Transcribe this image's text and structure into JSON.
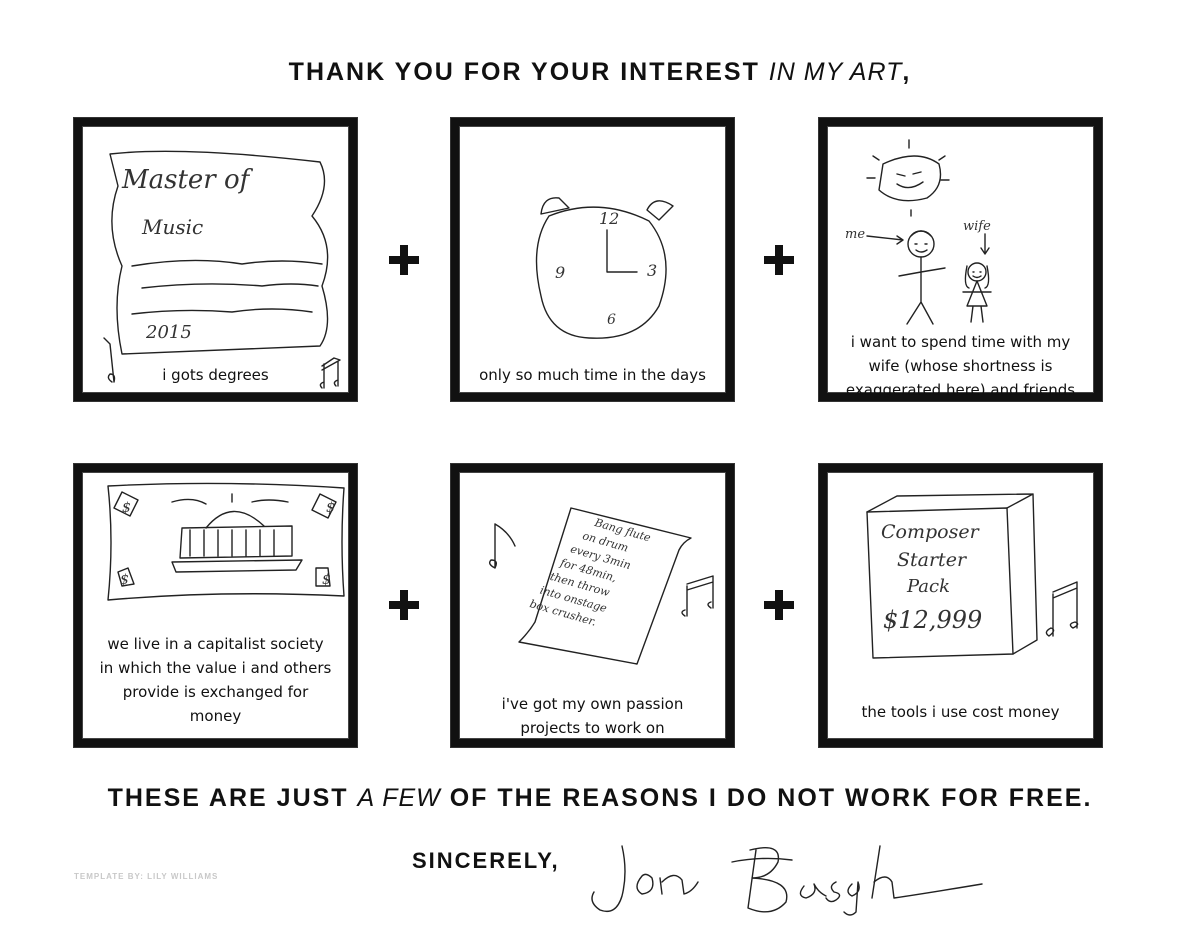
{
  "title": {
    "part1": "THANK YOU FOR YOUR INTEREST",
    "part2": "IN MY ART",
    "part3": ","
  },
  "panels": [
    {
      "caption": [
        "i gots degrees"
      ],
      "sketch_text": {
        "line1": "Master of",
        "line2": "Music",
        "year": "2015"
      }
    },
    {
      "caption": [
        "only so much time in the days"
      ],
      "sketch_text": {
        "n12": "12",
        "n3": "3",
        "n6": "6",
        "n9": "9"
      }
    },
    {
      "caption": [
        "i want to spend time with my",
        "wife (whose shortness is",
        "exaggerated here) and friends"
      ],
      "sketch_text": {
        "me": "me",
        "wife": "wife"
      }
    },
    {
      "caption": [
        "we live in a capitalist society",
        "in which the value i and others",
        "provide is exchanged for",
        "money"
      ],
      "sketch_text": {
        "dollar": "$"
      }
    },
    {
      "caption": [
        "i've got my own passion",
        "projects to work on"
      ],
      "sketch_text": {
        "lines": [
          "Bang flute",
          "on drum",
          "every 3min",
          "for 48min,",
          "then throw",
          "into onstage",
          "box crusher."
        ]
      }
    },
    {
      "caption": [
        "the tools i use cost money"
      ],
      "sketch_text": {
        "line1": "Composer",
        "line2": "Starter",
        "line3": "Pack",
        "price": "$12,999"
      }
    }
  ],
  "reasons": {
    "part1": "THESE ARE JUST",
    "part2": "A FEW",
    "part3": "OF THE REASONS I DO NOT WORK FOR FREE."
  },
  "signoff": "SINCERELY,",
  "credit": "TEMPLATE BY: LILY WILLIAMS",
  "signature_text": "Jon Bash"
}
